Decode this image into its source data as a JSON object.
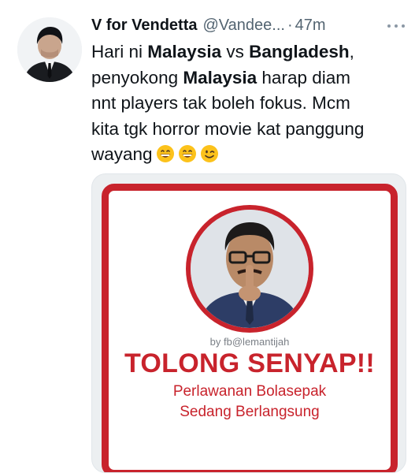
{
  "tweet": {
    "author_name": "V for Vendetta",
    "handle": "@Vandee...",
    "separator": "·",
    "time": "47m",
    "text": {
      "l1_a": "Hari ni ",
      "l1_b": "Malaysia",
      "l1_c": " vs ",
      "l1_d": "Bangladesh",
      "l1_e": ",",
      "l2_a": "penyokong ",
      "l2_b": "Malaysia",
      "l2_c": " harap diam",
      "l3": "nnt players tak boleh fokus. Mcm",
      "l4": "kita tgk horror movie kat panggung",
      "l5": "wayang"
    },
    "emojis": [
      "grinning-face",
      "grinning-face",
      "winking-face"
    ],
    "icons": {
      "more": "more-horizontal-icon"
    }
  },
  "media": {
    "credit": "by fb@lemantijah",
    "headline": "TOLONG SENYAP!!",
    "line1": "Perlawanan Bolasepak",
    "line2": "Sedang Berlangsung"
  },
  "colors": {
    "poster_red": "#c8232c",
    "secondary_text": "#536471",
    "primary_text": "#0f1419"
  }
}
